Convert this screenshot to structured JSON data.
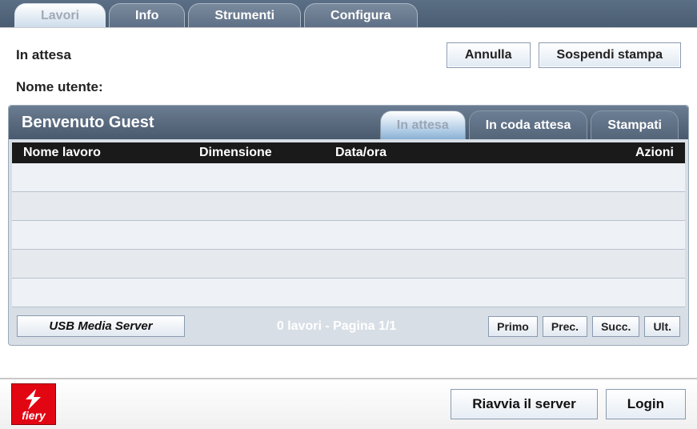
{
  "tabs": {
    "lavori": "Lavori",
    "info": "Info",
    "strumenti": "Strumenti",
    "configura": "Configura"
  },
  "status": {
    "label": "In attesa"
  },
  "actions": {
    "cancel": "Annulla",
    "pause": "Sospendi stampa"
  },
  "user": {
    "label": "Nome utente:"
  },
  "panel": {
    "welcome": "Benvenuto Guest",
    "subtabs": {
      "waiting": "In attesa",
      "queue": "In coda attesa",
      "printed": "Stampati"
    },
    "columns": {
      "name": "Nome lavoro",
      "size": "Dimensione",
      "date": "Data/ora",
      "actions": "Azioni"
    },
    "usb": "USB Media Server",
    "pager": {
      "summary": "0 lavori - Pagina 1/1",
      "first": "Primo",
      "prev": "Prec.",
      "next": "Succ.",
      "last": "Ult."
    }
  },
  "bottom": {
    "logo": "fiery",
    "restart": "Riavvia il server",
    "login": "Login"
  }
}
